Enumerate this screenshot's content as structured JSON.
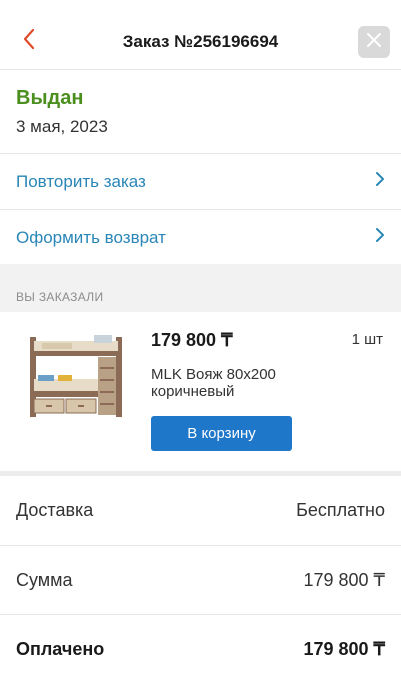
{
  "header": {
    "title": "Заказ №256196694"
  },
  "order": {
    "status": "Выдан",
    "date": "3 мая, 2023"
  },
  "actions": [
    {
      "label": "Повторить заказ"
    },
    {
      "label": "Оформить возврат"
    }
  ],
  "section": {
    "label": "ВЫ ЗАКАЗАЛИ"
  },
  "product": {
    "price": "179 800 ₸",
    "quantity": "1 шт",
    "name": "MLK Вояж 80х200 коричневый",
    "cart_button": "В корзину"
  },
  "summary": [
    {
      "label": "Доставка",
      "value": "Бесплатно"
    },
    {
      "label": "Сумма",
      "value": "179 800 ₸"
    },
    {
      "label": "Оплачено",
      "value": "179 800 ₸"
    }
  ],
  "colors": {
    "status_green": "#4b8f1f",
    "link_blue": "#2a86b7",
    "button_blue": "#1f77c9",
    "back_arrow": "#e04b2b"
  }
}
